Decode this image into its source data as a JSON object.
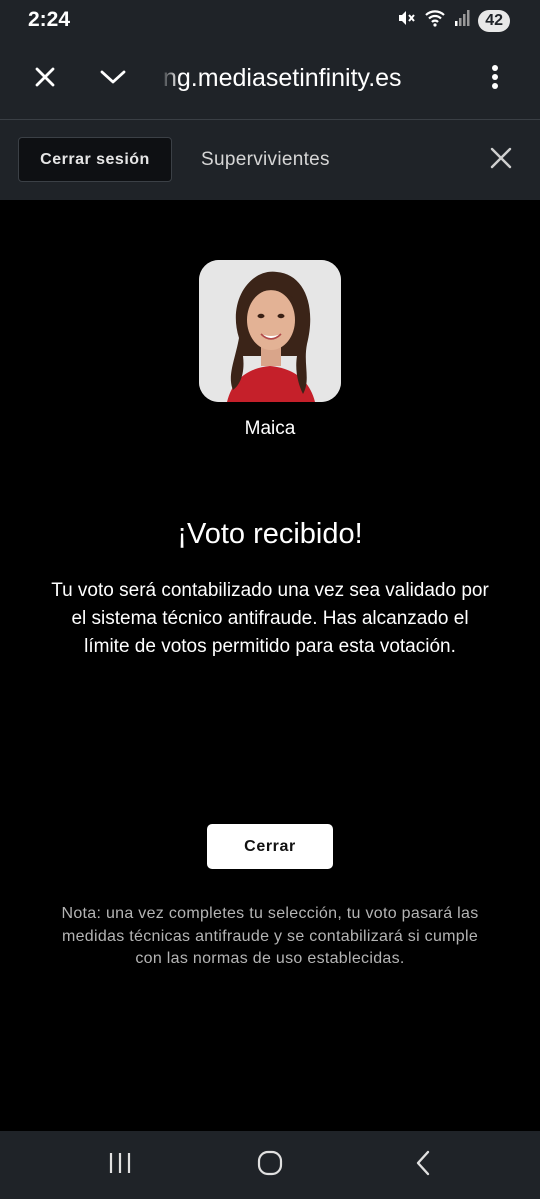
{
  "status_bar": {
    "time": "2:24",
    "battery": "42",
    "icons": [
      "mute-icon",
      "wifi-icon",
      "signal-icon",
      "battery-icon"
    ]
  },
  "browser": {
    "url": "ng.mediasetinfinity.es",
    "icons": [
      "close-icon",
      "chevron-down-icon",
      "more-vertical-icon"
    ]
  },
  "tab_bar": {
    "logout_label": "Cerrar sesión",
    "title": "Supervivientes",
    "icons": [
      "close-icon"
    ]
  },
  "content": {
    "candidate_name": "Maica",
    "heading": "¡Voto recibido!",
    "message": "Tu voto será contabilizado una vez sea validado por el sistema técnico antifraude. Has alcanzado el límite de votos permitido para esta votación.",
    "close_label": "Cerrar",
    "note": "Nota: una vez completes tu selección, tu voto pasará las medidas técnicas antifraude y se contabilizará si cumple con las normas de uso establecidas."
  },
  "nav_bar": {
    "icons": [
      "recent-apps-icon",
      "home-icon",
      "back-icon"
    ]
  },
  "colors": {
    "chrome_bg": "#1f2328",
    "content_bg": "#000000",
    "button_bg": "#ffffff",
    "logout_bg": "#0e1013",
    "note_text": "#b4b4b4"
  }
}
